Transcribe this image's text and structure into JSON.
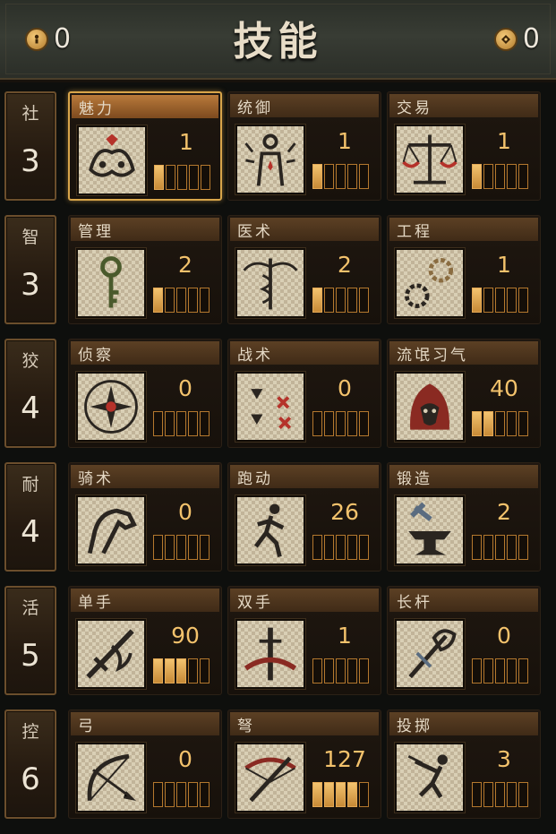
{
  "header": {
    "title": "技能",
    "left_counter": "0",
    "right_counter": "0"
  },
  "attributes": [
    {
      "name": "社",
      "value": "3"
    },
    {
      "name": "智",
      "value": "3"
    },
    {
      "name": "狡",
      "value": "4"
    },
    {
      "name": "耐",
      "value": "4"
    },
    {
      "name": "活",
      "value": "5"
    },
    {
      "name": "控",
      "value": "6"
    }
  ],
  "skills": [
    {
      "name": "魅力",
      "value": "1",
      "focus": 1,
      "icon": "mask-icon",
      "selected": true
    },
    {
      "name": "统御",
      "value": "1",
      "focus": 1,
      "icon": "leader-icon"
    },
    {
      "name": "交易",
      "value": "1",
      "focus": 1,
      "icon": "scales-icon"
    },
    {
      "name": "管理",
      "value": "2",
      "focus": 1,
      "icon": "key-icon"
    },
    {
      "name": "医术",
      "value": "2",
      "focus": 1,
      "icon": "caduceus-icon"
    },
    {
      "name": "工程",
      "value": "1",
      "focus": 1,
      "icon": "gears-icon"
    },
    {
      "name": "侦察",
      "value": "0",
      "focus": 0,
      "icon": "compass-icon"
    },
    {
      "name": "战术",
      "value": "0",
      "focus": 0,
      "icon": "tactics-icon"
    },
    {
      "name": "流氓习气",
      "value": "40",
      "focus": 2,
      "icon": "rogue-icon"
    },
    {
      "name": "骑术",
      "value": "0",
      "focus": 0,
      "icon": "horse-icon"
    },
    {
      "name": "跑动",
      "value": "26",
      "focus": 0,
      "icon": "runner-icon"
    },
    {
      "name": "锻造",
      "value": "2",
      "focus": 0,
      "icon": "anvil-icon"
    },
    {
      "name": "单手",
      "value": "90",
      "focus": 3,
      "icon": "one-handed-icon"
    },
    {
      "name": "双手",
      "value": "1",
      "focus": 0,
      "icon": "two-handed-icon"
    },
    {
      "name": "长杆",
      "value": "0",
      "focus": 0,
      "icon": "polearm-icon"
    },
    {
      "name": "弓",
      "value": "0",
      "focus": 0,
      "icon": "bow-icon"
    },
    {
      "name": "弩",
      "value": "127",
      "focus": 4,
      "icon": "crossbow-icon"
    },
    {
      "name": "投掷",
      "value": "3",
      "focus": 0,
      "icon": "throwing-icon"
    }
  ],
  "focus_max": 5,
  "colors": {
    "accent": "#f3c26c",
    "selected_border": "#d8a54a",
    "title": "#e8ddc8"
  }
}
